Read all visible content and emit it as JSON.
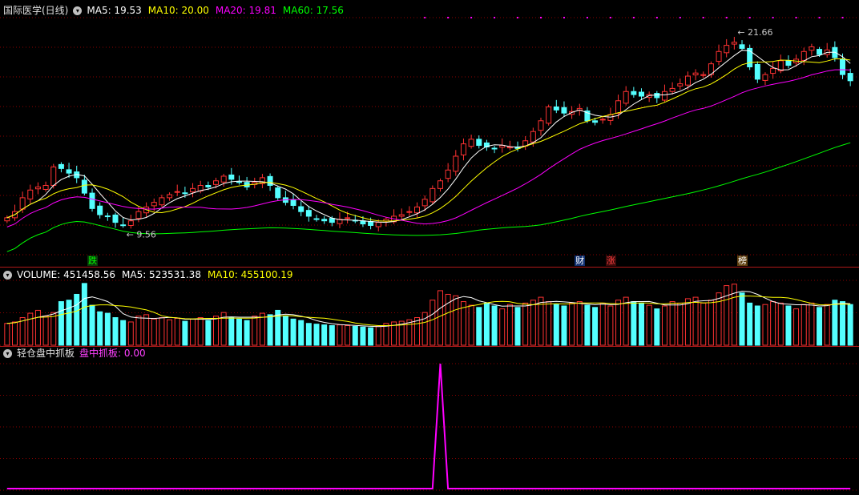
{
  "price_panel": {
    "title": "国际医学(日线)",
    "indicators": [
      {
        "label": "MA5: 19.53",
        "color": "#ffffff"
      },
      {
        "label": "MA10: 20.00",
        "color": "#ffff00"
      },
      {
        "label": "MA20: 19.81",
        "color": "#ff00ff"
      },
      {
        "label": "MA60: 17.56",
        "color": "#00ff00"
      }
    ],
    "high_label": "21.66",
    "low_label": "9.56",
    "annotations": [
      {
        "text": "跌",
        "color": "#00ff00",
        "bg": "#0a3a0a"
      },
      {
        "text": "财",
        "color": "#ffffff",
        "bg": "#103070"
      },
      {
        "text": "涨",
        "color": "#ff4040",
        "bg": "#3a0a0a"
      },
      {
        "text": "榜",
        "color": "#ffffff",
        "bg": "#604010"
      }
    ]
  },
  "volume_panel": {
    "indicators": [
      {
        "label": "VOLUME: 451458.56",
        "color": "#ffffff"
      },
      {
        "label": "MA5: 523531.38",
        "color": "#ffffff"
      },
      {
        "label": "MA10: 455100.19",
        "color": "#ffff00"
      }
    ]
  },
  "signal_panel": {
    "title": "轻仓盘中抓板",
    "indicators": [
      {
        "label": "盘中抓板: 0.00",
        "color": "#ff40ff"
      }
    ]
  },
  "chart_data": {
    "type": "candlestick",
    "price_ylim": [
      7.8,
      23.2
    ],
    "closes": [
      10.2,
      10.6,
      11.5,
      12.0,
      12.2,
      12.3,
      13.5,
      13.4,
      13.1,
      12.8,
      11.8,
      10.8,
      10.4,
      10.3,
      9.9,
      9.7,
      10.0,
      10.6,
      10.9,
      11.2,
      11.5,
      11.7,
      11.9,
      11.8,
      12.1,
      12.3,
      12.2,
      12.6,
      12.9,
      12.7,
      12.5,
      12.2,
      12.5,
      12.8,
      12.3,
      11.5,
      11.2,
      11.0,
      10.6,
      10.3,
      10.1,
      10.0,
      9.9,
      10.1,
      10.2,
      10.0,
      9.8,
      9.7,
      9.9,
      10.1,
      10.3,
      10.4,
      10.6,
      10.9,
      11.4,
      12.1,
      12.6,
      13.3,
      14.2,
      15.0,
      15.3,
      14.9,
      14.8,
      14.7,
      14.9,
      14.8,
      14.7,
      15.2,
      15.8,
      16.5,
      17.4,
      17.2,
      17.0,
      17.1,
      17.3,
      16.5,
      16.4,
      16.6,
      16.9,
      17.8,
      18.4,
      18.2,
      18.1,
      18.2,
      18.0,
      18.4,
      18.6,
      18.9,
      19.4,
      19.6,
      19.5,
      20.2,
      21.0,
      21.4,
      21.6,
      21.2,
      20.0,
      19.2,
      19.5,
      19.9,
      20.4,
      20.1,
      20.5,
      21.0,
      21.3,
      20.8,
      21.1,
      20.6,
      19.5,
      19.1
    ],
    "volumes": [
      30,
      32,
      38,
      44,
      48,
      40,
      45,
      60,
      62,
      70,
      85,
      55,
      46,
      44,
      38,
      34,
      32,
      40,
      42,
      36,
      38,
      35,
      37,
      33,
      36,
      38,
      34,
      40,
      45,
      38,
      36,
      34,
      40,
      44,
      42,
      48,
      40,
      36,
      34,
      30,
      29,
      28,
      27,
      28,
      27,
      26,
      25,
      24,
      26,
      30,
      32,
      33,
      35,
      38,
      45,
      62,
      75,
      70,
      68,
      60,
      55,
      52,
      58,
      54,
      50,
      56,
      52,
      58,
      62,
      66,
      60,
      56,
      54,
      58,
      60,
      55,
      52,
      58,
      54,
      62,
      66,
      60,
      58,
      55,
      50,
      54,
      60,
      58,
      64,
      66,
      58,
      62,
      72,
      82,
      84,
      72,
      58,
      54,
      56,
      60,
      58,
      54,
      50,
      56,
      58,
      52,
      56,
      62,
      60,
      56
    ],
    "signal_ylim": [
      0,
      1
    ],
    "signal_values": [
      0,
      0,
      0,
      0,
      0,
      0,
      0,
      0,
      0,
      0,
      0,
      0,
      0,
      0,
      0,
      0,
      0,
      0,
      0,
      0,
      0,
      0,
      0,
      0,
      0,
      0,
      0,
      0,
      0,
      0,
      0,
      0,
      0,
      0,
      0,
      0,
      0,
      0,
      0,
      0,
      0,
      0,
      0,
      0,
      0,
      0,
      0,
      0,
      0,
      0,
      0,
      0,
      0,
      0,
      0,
      0,
      1,
      0,
      0,
      0,
      0,
      0,
      0,
      0,
      0,
      0,
      0,
      0,
      0,
      0,
      0,
      0,
      0,
      0,
      0,
      0,
      0,
      0,
      0,
      0,
      0,
      0,
      0,
      0,
      0,
      0,
      0,
      0,
      0,
      0,
      0,
      0,
      0,
      0,
      0,
      0,
      0,
      0,
      0,
      0,
      0,
      0,
      0,
      0,
      0,
      0,
      0,
      0,
      0,
      0
    ],
    "annotation_bars": [
      11,
      74,
      78,
      95
    ],
    "signal_line": [
      0,
      0,
      0,
      0,
      0,
      0,
      0,
      0,
      0,
      0,
      0,
      0,
      0,
      0,
      0,
      0,
      0,
      0,
      0,
      0,
      0,
      0,
      0,
      0,
      0,
      0,
      0,
      0,
      0,
      0,
      0,
      0,
      0,
      0,
      0,
      0,
      0,
      0,
      0,
      0,
      0,
      0,
      0,
      0,
      0,
      0,
      0,
      0,
      0,
      0,
      0,
      0,
      0,
      0,
      0,
      0,
      1,
      0,
      0,
      0,
      0,
      0,
      0,
      0,
      0,
      0,
      0,
      0,
      0,
      0,
      0,
      0,
      0,
      0,
      0,
      0,
      0,
      0,
      0,
      0,
      0,
      0,
      0,
      0,
      0,
      0,
      0,
      0,
      0,
      0,
      0,
      0,
      0,
      0,
      0,
      0,
      0,
      0,
      0,
      0,
      0,
      0,
      0,
      0,
      0,
      0,
      0,
      0,
      0,
      0
    ],
    "colors": {
      "up": "#ff3232",
      "down": "#54ffff",
      "ma5": "#ffffff",
      "ma10": "#ffff00",
      "ma20": "#ff00ff",
      "ma60": "#00ff00",
      "signal": "#ff00ff",
      "grid": "#8b0000"
    }
  }
}
